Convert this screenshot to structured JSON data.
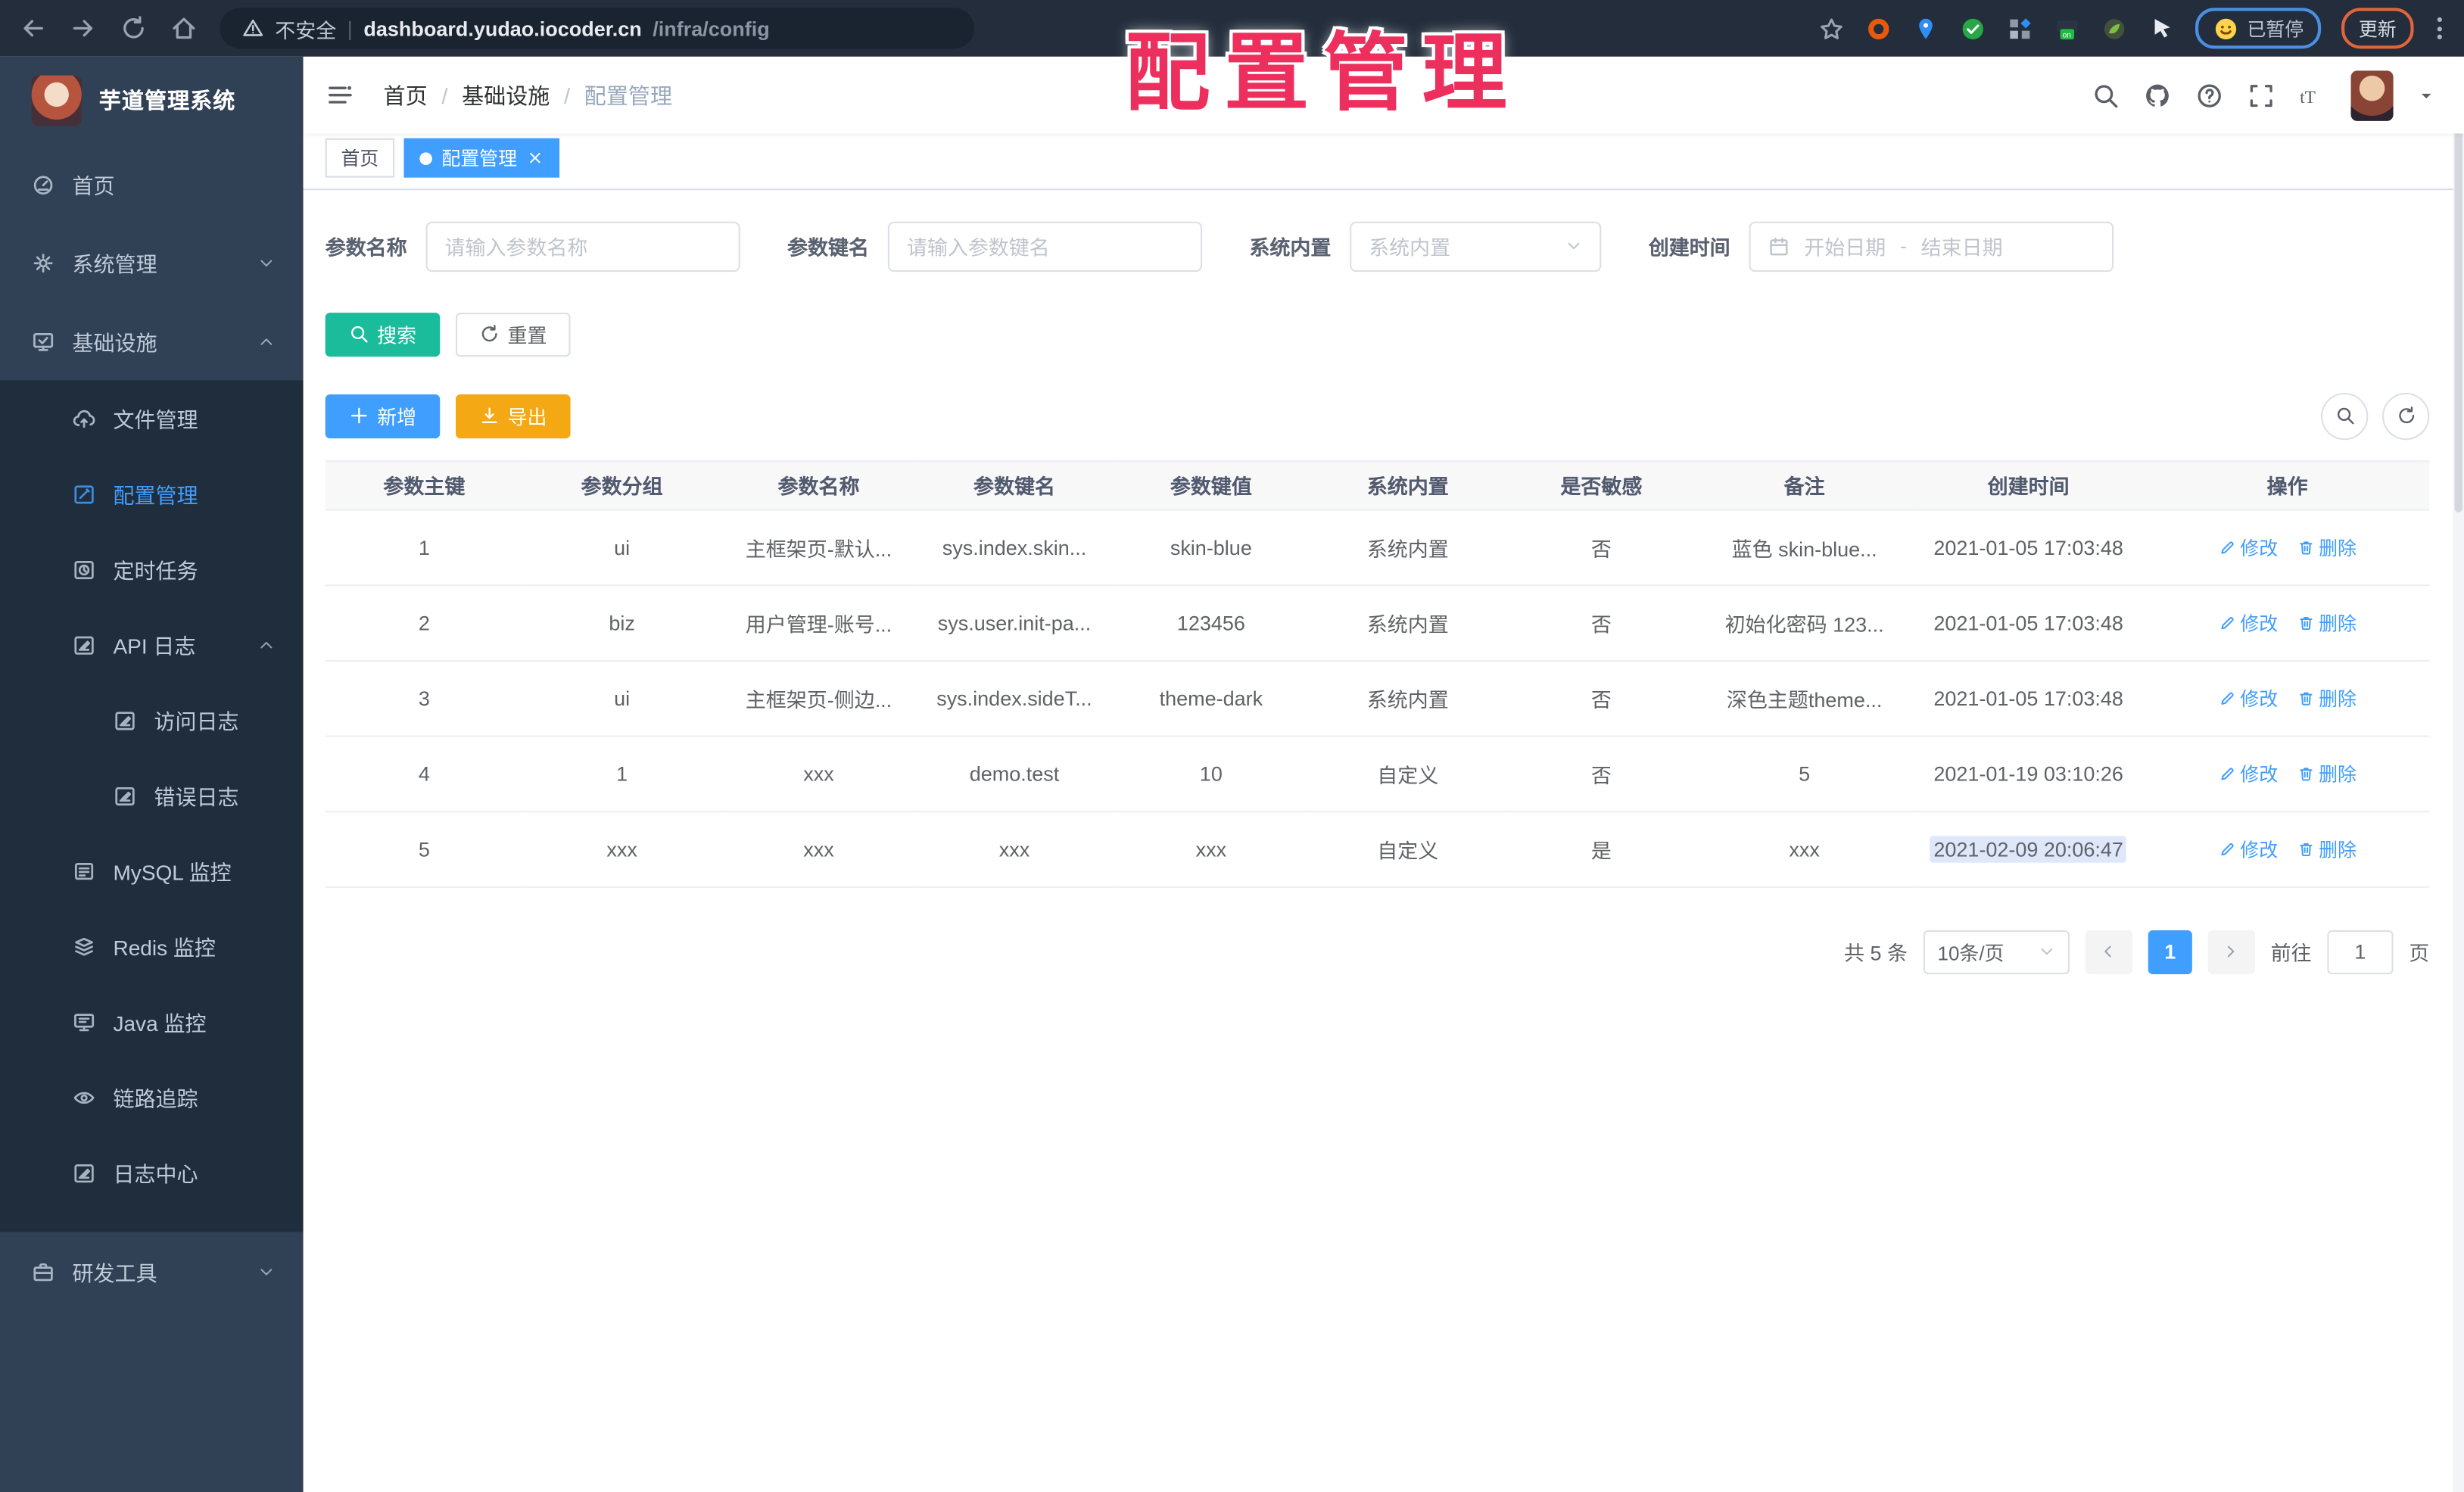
{
  "watermark": {
    "text": "配置管理",
    "color": "#ed2f5e"
  },
  "browser": {
    "security_label": "不安全",
    "url_host": "dashboard.yudao.iocoder.cn",
    "url_path": "/infra/config",
    "paused_badge": "已暂停",
    "update_button": "更新",
    "nav_icons": [
      "back-icon",
      "forward-icon",
      "reload-icon",
      "home-icon"
    ],
    "extension_icons": [
      "bookmark-star-icon",
      "ext-orange-ring-icon",
      "ext-blue-pin-icon",
      "ext-green-check-icon",
      "ext-puzzle-icon",
      "ext-screen-on-icon",
      "ext-leaf-icon",
      "ext-pointer-icon"
    ]
  },
  "sidebar": {
    "app_title": "芋道管理系统",
    "items": [
      {
        "label": "首页",
        "icon": "dashboard-icon",
        "level": 1
      },
      {
        "label": "系统管理",
        "icon": "gear-icon",
        "level": 1,
        "chevron": "down"
      },
      {
        "label": "基础设施",
        "icon": "monitor-check-icon",
        "level": 1,
        "chevron": "up"
      },
      {
        "label": "文件管理",
        "icon": "cloud-upload-icon",
        "level": 2
      },
      {
        "label": "配置管理",
        "icon": "edit-square-icon",
        "level": 2,
        "active": true
      },
      {
        "label": "定时任务",
        "icon": "schedule-icon",
        "level": 2
      },
      {
        "label": "API 日志",
        "icon": "api-log-icon",
        "level": 2,
        "chevron": "up"
      },
      {
        "label": "访问日志",
        "icon": "access-log-icon",
        "level": 3
      },
      {
        "label": "错误日志",
        "icon": "error-log-icon",
        "level": 3
      },
      {
        "label": "MySQL 监控",
        "icon": "mysql-monitor-icon",
        "level": 2
      },
      {
        "label": "Redis 监控",
        "icon": "redis-monitor-icon",
        "level": 2
      },
      {
        "label": "Java 监控",
        "icon": "java-monitor-icon",
        "level": 2
      },
      {
        "label": "链路追踪",
        "icon": "trace-eye-icon",
        "level": 2
      },
      {
        "label": "日志中心",
        "icon": "log-center-icon",
        "level": 2
      },
      {
        "label": "研发工具",
        "icon": "devtools-icon",
        "level": 1,
        "chevron": "down"
      }
    ]
  },
  "header": {
    "breadcrumbs": [
      "首页",
      "基础设施",
      "配置管理"
    ],
    "right_icons": [
      "search-icon",
      "github-icon",
      "help-icon",
      "fullscreen-icon",
      "fontsize-icon"
    ]
  },
  "tabs": [
    {
      "label": "首页",
      "active": false,
      "closable": false
    },
    {
      "label": "配置管理",
      "active": true,
      "closable": true
    }
  ],
  "filters": [
    {
      "type": "input",
      "label": "参数名称",
      "placeholder": "请输入参数名称"
    },
    {
      "type": "input",
      "label": "参数键名",
      "placeholder": "请输入参数键名"
    },
    {
      "type": "select",
      "label": "系统内置",
      "placeholder": "系统内置"
    },
    {
      "type": "daterange",
      "label": "创建时间",
      "start_placeholder": "开始日期",
      "separator": "-",
      "end_placeholder": "结束日期"
    }
  ],
  "toolbar": {
    "search": "搜索",
    "reset": "重置",
    "add": "新增",
    "export": "导出"
  },
  "table": {
    "columns": [
      "参数主键",
      "参数分组",
      "参数名称",
      "参数键名",
      "参数键值",
      "系统内置",
      "是否敏感",
      "备注",
      "创建时间",
      "操作"
    ],
    "col_widths_pct": [
      9.4,
      9.4,
      9.3,
      9.3,
      9.4,
      9.3,
      9.1,
      10.2,
      11.1,
      13.5
    ],
    "rows": [
      [
        "1",
        "ui",
        "主框架页-默认...",
        "sys.index.skin...",
        "skin-blue",
        "系统内置",
        "否",
        "蓝色 skin-blue...",
        "2021-01-05 17:03:48"
      ],
      [
        "2",
        "biz",
        "用户管理-账号...",
        "sys.user.init-pa...",
        "123456",
        "系统内置",
        "否",
        "初始化密码 123...",
        "2021-01-05 17:03:48"
      ],
      [
        "3",
        "ui",
        "主框架页-侧边...",
        "sys.index.sideT...",
        "theme-dark",
        "系统内置",
        "否",
        "深色主题theme...",
        "2021-01-05 17:03:48"
      ],
      [
        "4",
        "1",
        "xxx",
        "demo.test",
        "10",
        "自定义",
        "否",
        "5",
        "2021-01-19 03:10:26"
      ],
      [
        "5",
        "xxx",
        "xxx",
        "xxx",
        "xxx",
        "自定义",
        "是",
        "xxx",
        "2021-02-09 20:06:47"
      ]
    ],
    "edit_label": "修改",
    "delete_label": "删除",
    "highlight_cell": {
      "row": 4,
      "col": 8
    }
  },
  "pagination": {
    "total": "共 5 条",
    "page_size": "10条/页",
    "current_page": "1",
    "goto_label": "前往",
    "goto_value": "1",
    "page_unit": "页"
  },
  "colors": {
    "accent": "#409eff",
    "search_button": "#1abc9c",
    "add_button": "#409eff",
    "export_button": "#f4a814",
    "sidebar_bg": "#304156",
    "submenu_bg": "#1f2d3d",
    "tab_active": "#409eff",
    "watermark": "#ed2f5e"
  }
}
